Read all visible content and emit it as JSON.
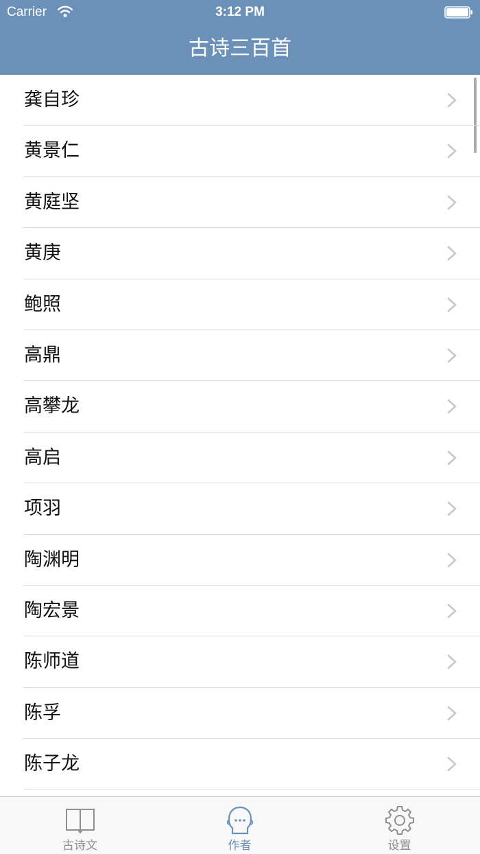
{
  "status_bar": {
    "carrier": "Carrier",
    "time": "3:12 PM"
  },
  "nav": {
    "title": "古诗三百首"
  },
  "authors": [
    "龚自珍",
    "黄景仁",
    "黄庭坚",
    "黄庚",
    "鲍照",
    "高鼎",
    "高攀龙",
    "高启",
    "项羽",
    "陶渊明",
    "陶宏景",
    "陈师道",
    "陈孚",
    "陈子龙"
  ],
  "tabs": [
    {
      "label": "古诗文",
      "icon": "book-icon",
      "active": false
    },
    {
      "label": "作者",
      "icon": "author-face-icon",
      "active": true
    },
    {
      "label": "设置",
      "icon": "gear-icon",
      "active": false
    }
  ],
  "colors": {
    "accent": "#6b91b8",
    "inactive": "#8e8e93",
    "separator": "#dcdcdc"
  }
}
